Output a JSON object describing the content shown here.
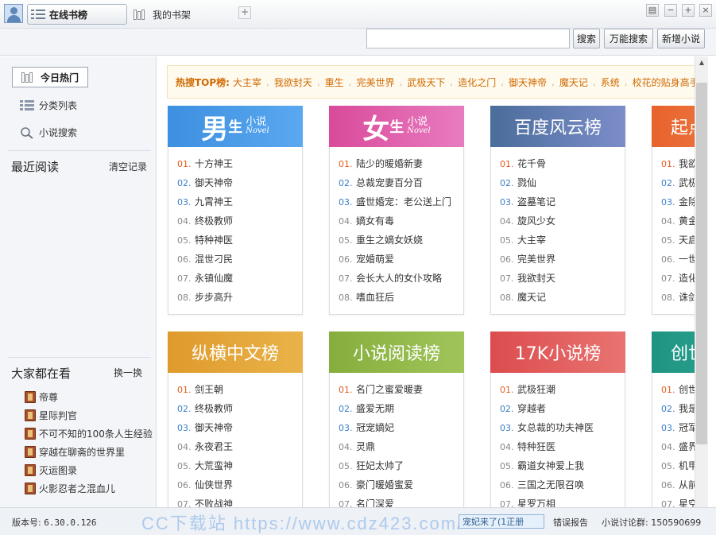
{
  "tabs": [
    {
      "label": "在线书榜",
      "icon": "list-icon",
      "active": true
    },
    {
      "label": "我的书架",
      "icon": "bookshelf-icon",
      "active": false
    }
  ],
  "window_controls": [
    "settings",
    "minimize",
    "maximize",
    "close"
  ],
  "search": {
    "placeholder": "",
    "buttons": {
      "search": "搜索",
      "universal": "万能搜索",
      "add_novel": "新增小说"
    }
  },
  "sidebar": {
    "hot_today": "今日热门",
    "category_list": "分类列表",
    "novel_search": "小说搜索",
    "recent_title": "最近阅读",
    "clear_records": "清空记录",
    "everyone_title": "大家都在看",
    "refresh": "换一换",
    "everyone_books": [
      "帝尊",
      "星际判官",
      "不可不知的100条人生经验",
      "穿越在聊斋的世界里",
      "灭运图录",
      "火影忍者之混血儿"
    ]
  },
  "hotbar": {
    "label": "热搜TOP榜:",
    "items": [
      "大主宰",
      "我欲封天",
      "重生",
      "完美世界",
      "武极天下",
      "造化之门",
      "御天神帝",
      "魔天记",
      "系统",
      "校花的贴身高手"
    ]
  },
  "colors": {
    "male": "#3d8fe0",
    "female": "#d94a9a",
    "baidu": "#4a6d9b",
    "qidian": "#e86a36",
    "zongheng": "#e3a33a",
    "xiaoshuo": "#8db442",
    "k17": "#e05a5a",
    "chuangshi": "#2a9d8b",
    "rank_top": "#e55a1f",
    "rank_mid": "#3b7ec6"
  },
  "cards": [
    {
      "id": "male",
      "head": {
        "big": "男",
        "mid": "生",
        "small": "小说",
        "en": "Novel"
      },
      "items": [
        [
          "01.",
          "十方神王"
        ],
        [
          "02.",
          "御天神帝"
        ],
        [
          "03.",
          "九霄神王"
        ],
        [
          "04.",
          "终极教师"
        ],
        [
          "05.",
          "特种神医"
        ],
        [
          "06.",
          "混世刁民"
        ],
        [
          "07.",
          "永镇仙魔"
        ],
        [
          "08.",
          "步步高升"
        ]
      ]
    },
    {
      "id": "female",
      "head": {
        "big": "女",
        "mid": "生",
        "small": "小说",
        "en": "Novel"
      },
      "items": [
        [
          "01.",
          "陆少的暖婚新妻"
        ],
        [
          "02.",
          "总裁宠妻百分百"
        ],
        [
          "03.",
          "盛世婚宠：老公送上门"
        ],
        [
          "04.",
          "嫡女有毒"
        ],
        [
          "05.",
          "重生之嫡女妖娆"
        ],
        [
          "06.",
          "宠婚萌爱"
        ],
        [
          "07.",
          "会长大人的女仆攻略"
        ],
        [
          "08.",
          "嗜血狂后"
        ]
      ]
    },
    {
      "id": "baidu",
      "head": {
        "title": "百度风云榜"
      },
      "items": [
        [
          "01.",
          "花千骨"
        ],
        [
          "02.",
          "戮仙"
        ],
        [
          "03.",
          "盗墓笔记"
        ],
        [
          "04.",
          "旋风少女"
        ],
        [
          "05.",
          "大主宰"
        ],
        [
          "06.",
          "完美世界"
        ],
        [
          "07.",
          "我欲封天"
        ],
        [
          "08.",
          "魔天记"
        ]
      ]
    },
    {
      "id": "qidian",
      "head": {
        "title": "起点"
      },
      "items": [
        [
          "01.",
          "我欲"
        ],
        [
          "02.",
          "武极"
        ],
        [
          "03.",
          "金除"
        ],
        [
          "04.",
          "黄金"
        ],
        [
          "05.",
          "天启"
        ],
        [
          "06.",
          "一世"
        ],
        [
          "07.",
          "造化"
        ],
        [
          "08.",
          "诛剑"
        ]
      ]
    },
    {
      "id": "zongheng",
      "head": {
        "title": "纵横中文榜"
      },
      "items": [
        [
          "01.",
          "剑王朝"
        ],
        [
          "02.",
          "终极教师"
        ],
        [
          "03.",
          "御天神帝"
        ],
        [
          "04.",
          "永夜君王"
        ],
        [
          "05.",
          "大荒蛮神"
        ],
        [
          "06.",
          "仙侠世界"
        ],
        [
          "07.",
          "不败战神"
        ]
      ]
    },
    {
      "id": "xiaoshuo",
      "head": {
        "title": "小说阅读榜"
      },
      "items": [
        [
          "01.",
          "名门之蜜爱暖妻"
        ],
        [
          "02.",
          "盛爱无期"
        ],
        [
          "03.",
          "冠宠嫡妃"
        ],
        [
          "04.",
          "灵鼎"
        ],
        [
          "05.",
          "狂妃太帅了"
        ],
        [
          "06.",
          "豪门暖婚蜜爱"
        ],
        [
          "07.",
          "名门深爱"
        ]
      ]
    },
    {
      "id": "k17",
      "head": {
        "title": "17K小说榜"
      },
      "items": [
        [
          "01.",
          "武极狂潮"
        ],
        [
          "02.",
          "穿越者"
        ],
        [
          "03.",
          "女总裁的功夫神医"
        ],
        [
          "04.",
          "特种狂医"
        ],
        [
          "05.",
          "霸道女神爱上我"
        ],
        [
          "06.",
          "三国之无限召唤"
        ],
        [
          "07.",
          "星罗万相"
        ]
      ]
    },
    {
      "id": "chuangshi",
      "head": {
        "title": "创世"
      },
      "items": [
        [
          "01.",
          "创世"
        ],
        [
          "02.",
          "我是"
        ],
        [
          "03.",
          "冠军"
        ],
        [
          "04.",
          "盛界"
        ],
        [
          "05.",
          "机甲"
        ],
        [
          "06.",
          "从前"
        ],
        [
          "07.",
          "星空"
        ]
      ]
    }
  ],
  "status": {
    "version_label": "版本号:",
    "version": "6.30.0.126",
    "watermark": "CC下载站 https://www.cdz423.com/",
    "ad": "宠妃来了(1正册",
    "report": "错误报告",
    "qq_label": "小说讨论群:",
    "qq_number": "150590699"
  }
}
